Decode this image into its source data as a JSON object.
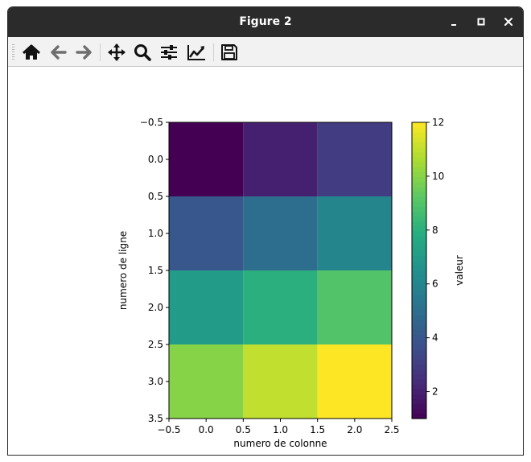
{
  "window": {
    "title": "Figure 2",
    "controls": [
      "minimize-icon",
      "maximize-icon",
      "close-icon"
    ]
  },
  "toolbar": {
    "items": [
      {
        "name": "home-button",
        "icon": "home-icon"
      },
      {
        "name": "back-button",
        "icon": "arrow-left-icon"
      },
      {
        "name": "forward-button",
        "icon": "arrow-right-icon"
      },
      {
        "name": "pan-button",
        "icon": "move-arrows-icon"
      },
      {
        "name": "zoom-button",
        "icon": "magnifier-icon"
      },
      {
        "name": "subplots-button",
        "icon": "sliders-icon"
      },
      {
        "name": "edit-axis-button",
        "icon": "line-chart-icon"
      },
      {
        "name": "save-button",
        "icon": "floppy-disk-icon"
      }
    ]
  },
  "chart_data": {
    "type": "heatmap",
    "matrix": [
      [
        1,
        2,
        3
      ],
      [
        4,
        5,
        6
      ],
      [
        7,
        8,
        9
      ],
      [
        10,
        11,
        12
      ]
    ],
    "xlabel": "numero de colonne",
    "ylabel": "numero de ligne",
    "xlim": [
      -0.5,
      2.5
    ],
    "ylim": [
      3.5,
      -0.5
    ],
    "xticks": [
      "−0.5",
      "0.0",
      "0.5",
      "1.0",
      "1.5",
      "2.0",
      "2.5"
    ],
    "yticks": [
      "−0.5",
      "0.0",
      "0.5",
      "1.0",
      "1.5",
      "2.0",
      "2.5",
      "3.0",
      "3.5"
    ],
    "colormap": "viridis",
    "colorbar": {
      "label": "valeur",
      "range": [
        1,
        12
      ],
      "ticks": [
        "2",
        "4",
        "6",
        "8",
        "10",
        "12"
      ]
    },
    "grid": false
  },
  "colors": {
    "titlebar": "#2b2b2b",
    "toolbar": "#f2f2f2",
    "icon": "#111111",
    "icon_disabled": "#6e6e6e"
  }
}
